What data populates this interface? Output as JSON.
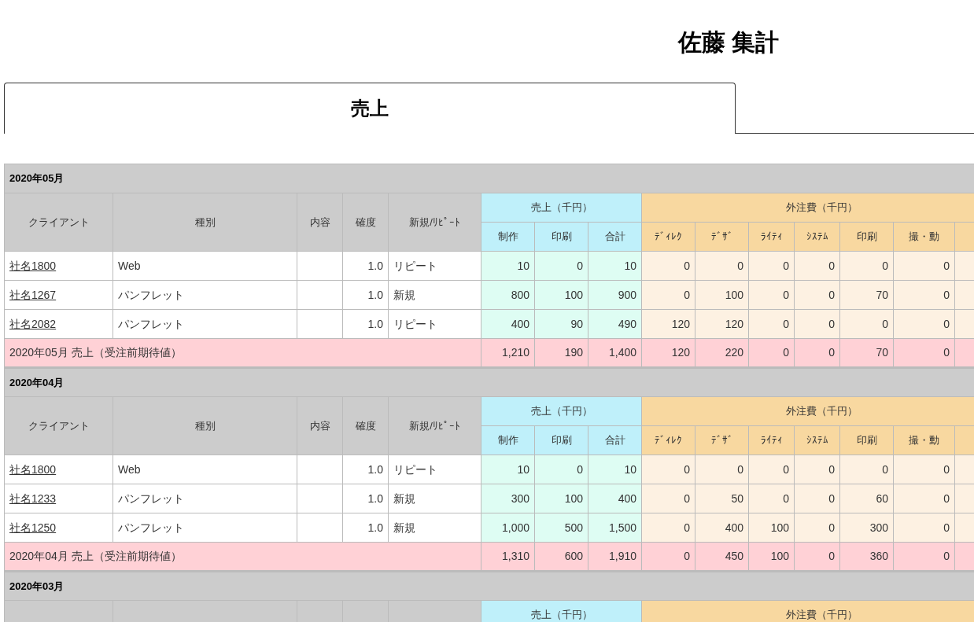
{
  "title": "佐藤 集計",
  "tabs": [
    {
      "label": "売上",
      "selected": true
    }
  ],
  "sections": [
    {
      "month": "2020年05月",
      "headers": {
        "client": "クライアント",
        "type": "種別",
        "content": "内容",
        "confidence": "確度",
        "new_repeat": "新規/ﾘﾋﾟｰﾄ",
        "sales_group": "売上（千円）",
        "sales_columns": [
          "制作",
          "印刷",
          "合計"
        ],
        "outsourcing_group": "外注費（千円）",
        "outsourcing_columns": [
          "ﾃﾞｨﾚｸ",
          "ﾃﾞｻﾞ",
          "ﾗｲﾃｨ",
          "ｼｽﾃﾑ",
          "印刷",
          "撮・動"
        ]
      },
      "rows": [
        {
          "client": "社名1800",
          "type": "Web",
          "confidence": "1.0",
          "new_repeat": "リピート",
          "sales": [
            "10",
            "0",
            "10"
          ],
          "outsourcing": [
            "0",
            "0",
            "0",
            "0",
            "0",
            "0"
          ]
        },
        {
          "client": "社名1267",
          "type": "パンフレット",
          "confidence": "1.0",
          "new_repeat": "新規",
          "sales": [
            "800",
            "100",
            "900"
          ],
          "outsourcing": [
            "0",
            "100",
            "0",
            "0",
            "70",
            "0"
          ]
        },
        {
          "client": "社名2082",
          "type": "パンフレット",
          "confidence": "1.0",
          "new_repeat": "リピート",
          "sales": [
            "400",
            "90",
            "490"
          ],
          "outsourcing": [
            "120",
            "120",
            "0",
            "0",
            "0",
            "0"
          ]
        }
      ],
      "total": {
        "label": "2020年05月 売上（受注前期待値）",
        "sales": [
          "1,210",
          "190",
          "1,400"
        ],
        "outsourcing": [
          "120",
          "220",
          "0",
          "0",
          "70",
          "0"
        ]
      }
    },
    {
      "month": "2020年04月",
      "headers": {
        "client": "クライアント",
        "type": "種別",
        "content": "内容",
        "confidence": "確度",
        "new_repeat": "新規/ﾘﾋﾟｰﾄ",
        "sales_group": "売上（千円）",
        "sales_columns": [
          "制作",
          "印刷",
          "合計"
        ],
        "outsourcing_group": "外注費（千円）",
        "outsourcing_columns": [
          "ﾃﾞｨﾚｸ",
          "ﾃﾞｻﾞ",
          "ﾗｲﾃｨ",
          "ｼｽﾃﾑ",
          "印刷",
          "撮・動"
        ]
      },
      "rows": [
        {
          "client": "社名1800",
          "type": "Web",
          "confidence": "1.0",
          "new_repeat": "リピート",
          "sales": [
            "10",
            "0",
            "10"
          ],
          "outsourcing": [
            "0",
            "0",
            "0",
            "0",
            "0",
            "0"
          ]
        },
        {
          "client": "社名1233",
          "type": "パンフレット",
          "confidence": "1.0",
          "new_repeat": "新規",
          "sales": [
            "300",
            "100",
            "400"
          ],
          "outsourcing": [
            "0",
            "50",
            "0",
            "0",
            "60",
            "0"
          ]
        },
        {
          "client": "社名1250",
          "type": "パンフレット",
          "confidence": "1.0",
          "new_repeat": "新規",
          "sales": [
            "1,000",
            "500",
            "1,500"
          ],
          "outsourcing": [
            "0",
            "400",
            "100",
            "0",
            "300",
            "0"
          ]
        }
      ],
      "total": {
        "label": "2020年04月 売上（受注前期待値）",
        "sales": [
          "1,310",
          "600",
          "1,910"
        ],
        "outsourcing": [
          "0",
          "450",
          "100",
          "0",
          "360",
          "0"
        ]
      }
    },
    {
      "month": "2020年03月",
      "headers": {
        "sales_group": "売上（千円）",
        "outsourcing_group": "外注費（千円）"
      }
    }
  ]
}
